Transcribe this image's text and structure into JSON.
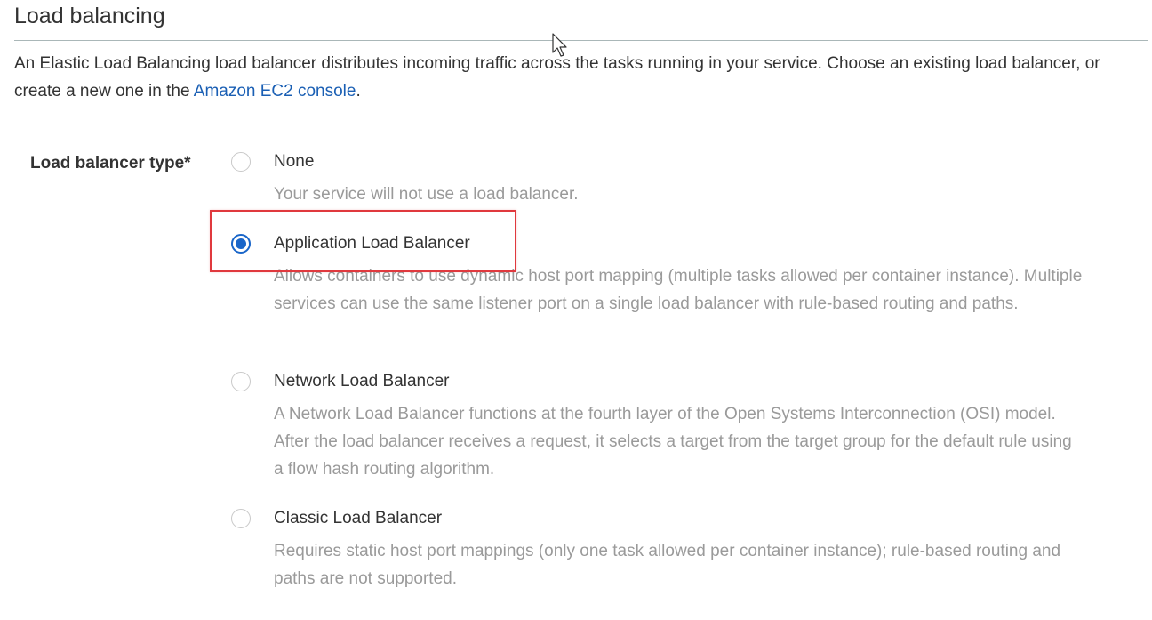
{
  "section": {
    "title": "Load balancing"
  },
  "intro": {
    "text_before_link": "An Elastic Load Balancing load balancer distributes incoming traffic across the tasks running in your service. Choose an existing load balancer, or create a new one in the ",
    "link_text": "Amazon EC2 console",
    "text_after_link": "."
  },
  "field": {
    "label": "Load balancer type*"
  },
  "options": [
    {
      "label": "None",
      "description": "Your service will not use a load balancer.",
      "selected": false
    },
    {
      "label": "Application Load Balancer",
      "description": "Allows containers to use dynamic host port mapping (multiple tasks allowed per container instance). Multiple services can use the same listener port on a single load balancer with rule-based routing and paths.",
      "selected": true
    },
    {
      "label": "Network Load Balancer",
      "description": "A Network Load Balancer functions at the fourth layer of the Open Systems Interconnection (OSI) model. After the load balancer receives a request, it selects a target from the target group for the default rule using a flow hash routing algorithm.",
      "selected": false
    },
    {
      "label": "Classic Load Balancer",
      "description": "Requires static host port mappings (only one task allowed per container instance); rule-based routing and paths are not supported.",
      "selected": false
    }
  ],
  "colors": {
    "link": "#1a5fb4",
    "radio_selected": "#1a66c9",
    "highlight_border": "#e0393e",
    "description_text": "#9a9a9a"
  },
  "icons": {
    "cursor": "mouse-pointer-icon"
  }
}
